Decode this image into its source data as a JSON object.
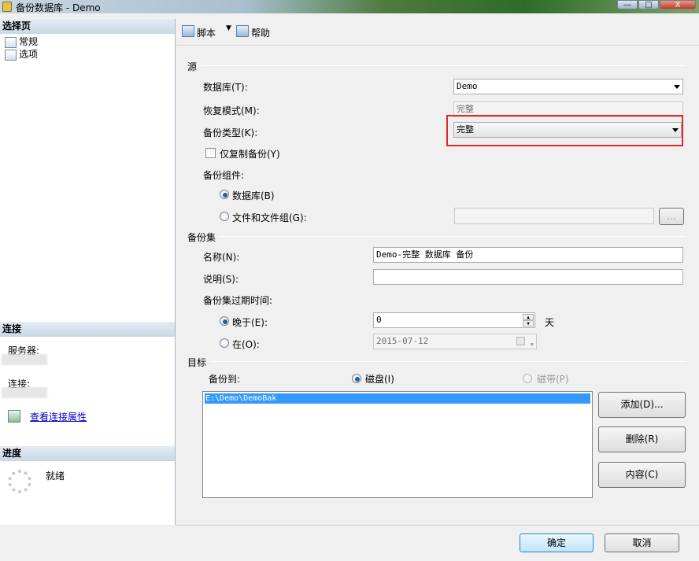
{
  "window": {
    "title": "备份数据库 - Demo",
    "controls": {
      "minimize": "—",
      "maximize": "□",
      "close": "X"
    }
  },
  "left": {
    "select_page": {
      "heading": "选择页",
      "items": [
        {
          "label": "常规",
          "icon": "page-settings-icon"
        },
        {
          "label": "选项",
          "icon": "page-settings-icon"
        }
      ]
    },
    "connection": {
      "heading": "连接",
      "server_label": "服务器:",
      "connection_label": "连接:",
      "view_properties": "查看连接属性"
    },
    "progress": {
      "heading": "进度",
      "status": "就绪"
    }
  },
  "toolbar": {
    "script": "脚本",
    "help": "帮助"
  },
  "source": {
    "title": "源",
    "database_label": "数据库(T):",
    "database_value": "Demo",
    "recovery_label": "恢复模式(M):",
    "recovery_value": "完整",
    "backup_type_label": "备份类型(K):",
    "backup_type_value": "完整",
    "copy_only_label": "仅复制备份(Y)",
    "copy_only_checked": false,
    "component_label": "备份组件:",
    "component_database": "数据库(B)",
    "component_files": "文件和文件组(G):",
    "component_selected": "database",
    "browse_button": "..."
  },
  "backup_set": {
    "title": "备份集",
    "name_label": "名称(N):",
    "name_value": "Demo-完整 数据库 备份",
    "desc_label": "说明(S):",
    "desc_value": "",
    "expire_label": "备份集过期时间:",
    "after_label": "晚于(E):",
    "after_value": "0",
    "after_unit": "天",
    "on_label": "在(O):",
    "on_value": "2015-07-12",
    "expire_selected": "after"
  },
  "destination": {
    "title": "目标",
    "backup_to_label": "备份到:",
    "disk_label": "磁盘(I)",
    "tape_label": "磁带(P)",
    "selected": "disk",
    "paths": [
      "E:\\Demo\\DemoBak"
    ],
    "add_button": "添加(D)...",
    "remove_button": "删除(R)",
    "contents_button": "内容(C)"
  },
  "footer": {
    "ok": "确定",
    "cancel": "取消"
  },
  "colors": {
    "highlight_box": "#e02a2a",
    "selection": "#3399ff",
    "link": "#0000cc"
  }
}
